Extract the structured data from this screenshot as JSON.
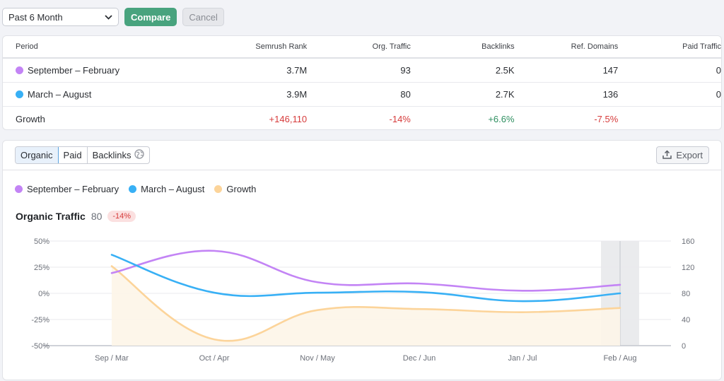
{
  "toolbar": {
    "period_select": "Past 6 Month",
    "compare_label": "Compare",
    "cancel_label": "Cancel"
  },
  "colors": {
    "period1": "#c384f5",
    "period2": "#38b0f5",
    "growth": "#fcd49a",
    "growth_fill": "#fdf5e8",
    "positive": "#2e8f60",
    "negative": "#d63b3b",
    "accent": "#48a37e"
  },
  "table": {
    "headers": [
      "Period",
      "Semrush Rank",
      "Org. Traffic",
      "Backlinks",
      "Ref. Domains",
      "Paid Traffic"
    ],
    "rows": [
      {
        "label": "September – February",
        "dot": "period1",
        "values": [
          "3.7M",
          "93",
          "2.5K",
          "147",
          "0"
        ]
      },
      {
        "label": "March – August",
        "dot": "period2",
        "values": [
          "3.9M",
          "80",
          "2.7K",
          "136",
          "0"
        ]
      },
      {
        "label": "Growth",
        "values": [
          "+146,110",
          "-14%",
          "+6.6%",
          "-7.5%",
          ""
        ],
        "tone": [
          "negative",
          "negative",
          "positive",
          "negative",
          ""
        ]
      }
    ]
  },
  "chart_panel": {
    "tabs": [
      {
        "label": "Organic",
        "active": true
      },
      {
        "label": "Paid",
        "active": false
      },
      {
        "label": "Backlinks",
        "active": false,
        "icon": "globe-icon"
      }
    ],
    "export_label": "Export",
    "legend": [
      {
        "label": "September – February",
        "color": "period1"
      },
      {
        "label": "March – August",
        "color": "period2"
      },
      {
        "label": "Growth",
        "color": "growth"
      }
    ],
    "metric": {
      "title": "Organic Traffic",
      "value": "80",
      "badge": "-14%"
    }
  },
  "chart_data": {
    "type": "line",
    "title": "Organic Traffic",
    "categories": [
      "Sep / Mar",
      "Oct / Apr",
      "Nov / May",
      "Dec / Jun",
      "Jan / Jul",
      "Feb / Aug"
    ],
    "series": [
      {
        "name": "September – February",
        "axis": "right",
        "values": [
          111,
          145,
          97,
          95,
          84,
          93
        ]
      },
      {
        "name": "March – August",
        "axis": "right",
        "values": [
          139,
          81,
          81,
          82,
          68,
          80
        ]
      },
      {
        "name": "Growth",
        "axis": "left",
        "type": "area",
        "unit": "%",
        "values": [
          26,
          -44,
          -16,
          -15,
          -18,
          -14
        ]
      }
    ],
    "y_left": {
      "ticks": [
        "50%",
        "25%",
        "0%",
        "-25%",
        "-50%"
      ],
      "range": [
        -50,
        50
      ]
    },
    "y_right": {
      "ticks": [
        "160",
        "120",
        "80",
        "40",
        "0"
      ],
      "range": [
        0,
        160
      ]
    },
    "highlighted_category": "Feb / Aug",
    "grid": true
  }
}
